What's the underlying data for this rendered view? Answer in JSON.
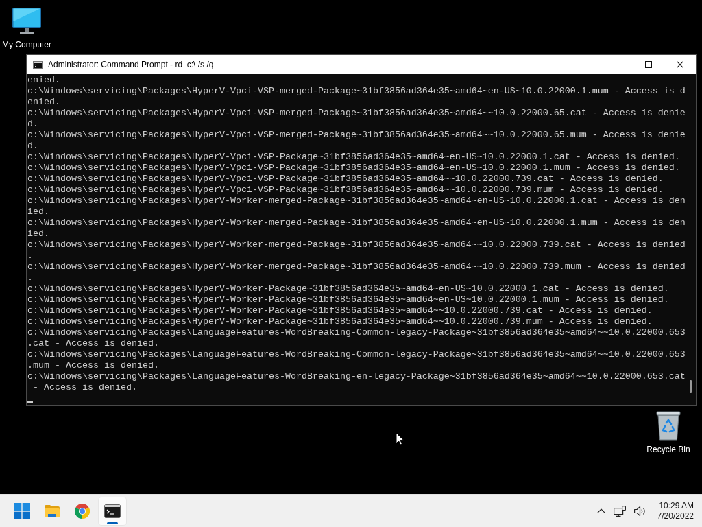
{
  "desktop_icons": [
    {
      "kind": "computer",
      "label": "My Computer"
    },
    {
      "kind": "recycle_bin",
      "label": "Recycle Bin"
    }
  ],
  "window": {
    "title": "Administrator: Command Prompt - rd  c:\\ /s /q"
  },
  "console": {
    "lines": [
      "enied.",
      "c:\\Windows\\servicing\\Packages\\HyperV-Vpci-VSP-merged-Package~31bf3856ad364e35~amd64~en-US~10.0.22000.1.mum - Access is d",
      "enied.",
      "c:\\Windows\\servicing\\Packages\\HyperV-Vpci-VSP-merged-Package~31bf3856ad364e35~amd64~~10.0.22000.65.cat - Access is denie",
      "d.",
      "c:\\Windows\\servicing\\Packages\\HyperV-Vpci-VSP-merged-Package~31bf3856ad364e35~amd64~~10.0.22000.65.mum - Access is denie",
      "d.",
      "c:\\Windows\\servicing\\Packages\\HyperV-Vpci-VSP-Package~31bf3856ad364e35~amd64~en-US~10.0.22000.1.cat - Access is denied.",
      "c:\\Windows\\servicing\\Packages\\HyperV-Vpci-VSP-Package~31bf3856ad364e35~amd64~en-US~10.0.22000.1.mum - Access is denied.",
      "c:\\Windows\\servicing\\Packages\\HyperV-Vpci-VSP-Package~31bf3856ad364e35~amd64~~10.0.22000.739.cat - Access is denied.",
      "c:\\Windows\\servicing\\Packages\\HyperV-Vpci-VSP-Package~31bf3856ad364e35~amd64~~10.0.22000.739.mum - Access is denied.",
      "c:\\Windows\\servicing\\Packages\\HyperV-Worker-merged-Package~31bf3856ad364e35~amd64~en-US~10.0.22000.1.cat - Access is den",
      "ied.",
      "c:\\Windows\\servicing\\Packages\\HyperV-Worker-merged-Package~31bf3856ad364e35~amd64~en-US~10.0.22000.1.mum - Access is den",
      "ied.",
      "c:\\Windows\\servicing\\Packages\\HyperV-Worker-merged-Package~31bf3856ad364e35~amd64~~10.0.22000.739.cat - Access is denied",
      ".",
      "c:\\Windows\\servicing\\Packages\\HyperV-Worker-merged-Package~31bf3856ad364e35~amd64~~10.0.22000.739.mum - Access is denied",
      ".",
      "c:\\Windows\\servicing\\Packages\\HyperV-Worker-Package~31bf3856ad364e35~amd64~en-US~10.0.22000.1.cat - Access is denied.",
      "c:\\Windows\\servicing\\Packages\\HyperV-Worker-Package~31bf3856ad364e35~amd64~en-US~10.0.22000.1.mum - Access is denied.",
      "c:\\Windows\\servicing\\Packages\\HyperV-Worker-Package~31bf3856ad364e35~amd64~~10.0.22000.739.cat - Access is denied.",
      "c:\\Windows\\servicing\\Packages\\HyperV-Worker-Package~31bf3856ad364e35~amd64~~10.0.22000.739.mum - Access is denied.",
      "c:\\Windows\\servicing\\Packages\\LanguageFeatures-WordBreaking-Common-legacy-Package~31bf3856ad364e35~amd64~~10.0.22000.653",
      ".cat - Access is denied.",
      "c:\\Windows\\servicing\\Packages\\LanguageFeatures-WordBreaking-Common-legacy-Package~31bf3856ad364e35~amd64~~10.0.22000.653",
      ".mum - Access is denied.",
      "c:\\Windows\\servicing\\Packages\\LanguageFeatures-WordBreaking-en-legacy-Package~31bf3856ad364e35~amd64~~10.0.22000.653.cat",
      " - Access is denied."
    ],
    "cursor": true
  },
  "taskbar": {
    "apps": [
      {
        "kind": "folder",
        "active": false
      },
      {
        "kind": "browser",
        "active": false
      },
      {
        "kind": "terminal",
        "active": true
      }
    ],
    "clock": {
      "time": "10:29 AM",
      "date": "7/20/2022"
    }
  }
}
